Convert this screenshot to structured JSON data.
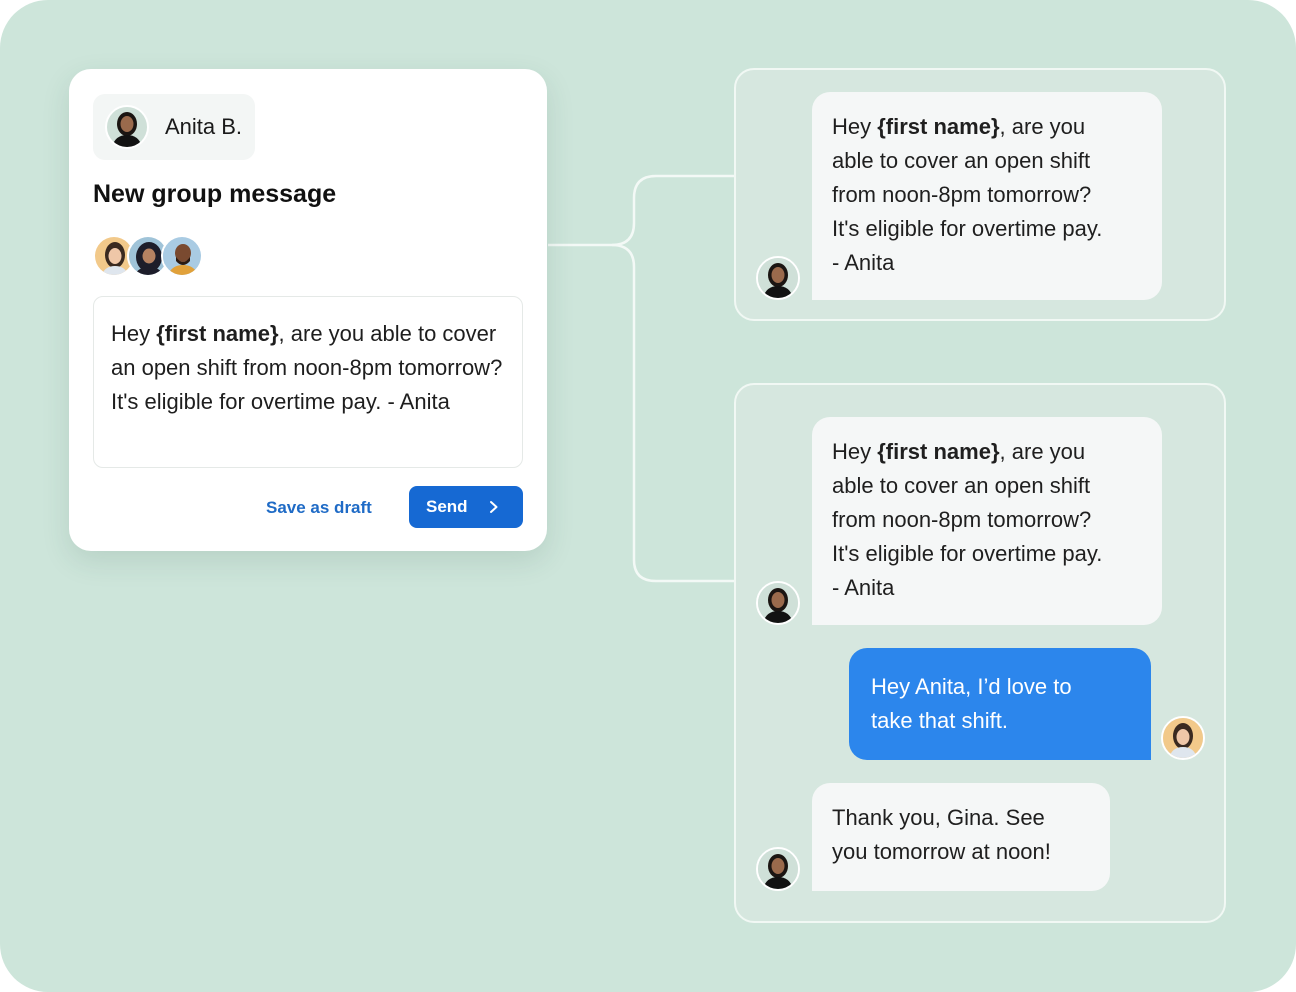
{
  "composer": {
    "sender_name": "Anita B.",
    "title": "New group message",
    "message_prefix": "Hey ",
    "message_token": "{first name}",
    "message_rest": ", are you able to cover an open shift from noon-8pm tomorrow? It's eligible for overtime pay. - Anita",
    "draft_label": "Save as draft",
    "send_label": "Send"
  },
  "thread_1": {
    "messages": [
      {
        "line1_prefix": "Hey ",
        "line1_token": "{first name}",
        "line1_rest": ", are you",
        "line2": "able to cover an open shift",
        "line3": "from noon-8pm tomorrow?",
        "line4": "It's eligible for overtime pay.",
        "line5": "- Anita"
      }
    ]
  },
  "thread_2": {
    "messages": [
      {
        "line1_prefix": "Hey ",
        "line1_token": "{first name}",
        "line1_rest": ", are you",
        "line2": "able to cover an open shift",
        "line3": "from noon-8pm tomorrow?",
        "line4": "It's eligible for overtime pay.",
        "line5": "- Anita"
      },
      {
        "line1": "Hey Anita, I’d love to",
        "line2": "take that shift."
      },
      {
        "line1": "Thank you, Gina. See",
        "line2": "you tomorrow at noon!"
      }
    ]
  },
  "colors": {
    "background": "#cde5da",
    "primary_button": "#1669d3",
    "outgoing_bubble": "#2c86ec",
    "link": "#1f6bc6"
  },
  "icons": [
    "avatar-anita",
    "avatar-gina",
    "avatar-recipient-2",
    "avatar-recipient-3",
    "chevron-right-icon"
  ]
}
